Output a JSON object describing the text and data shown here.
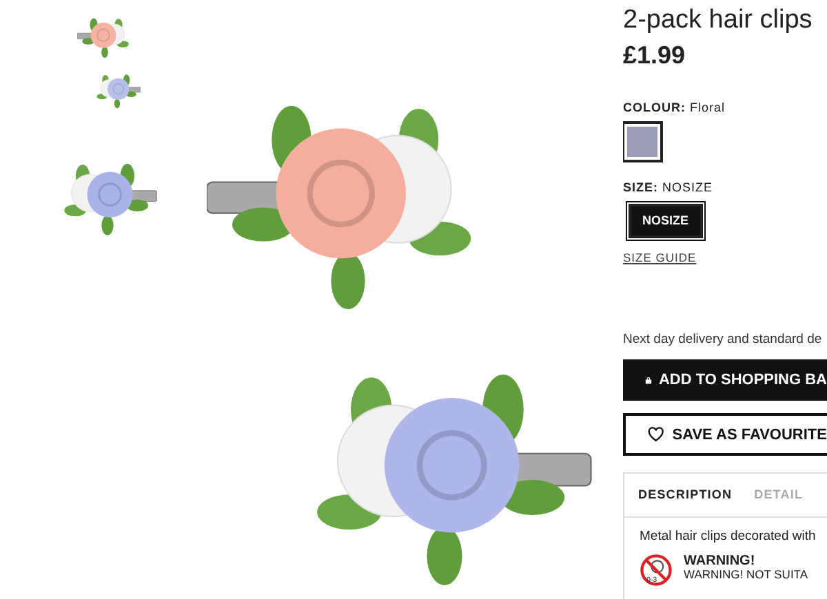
{
  "product": {
    "title": "2-pack hair clips",
    "price": "£1.99"
  },
  "colour": {
    "label": "COLOUR:",
    "value": "Floral",
    "swatches": [
      {
        "color": "#9a9cb8",
        "selected": true
      }
    ]
  },
  "size": {
    "label": "SIZE:",
    "value": "NOSIZE",
    "options": [
      {
        "label": "NOSIZE",
        "selected": true
      }
    ],
    "guide": "SIZE GUIDE"
  },
  "delivery": "Next day delivery and standard de",
  "buttons": {
    "add": "ADD TO SHOPPING BA",
    "save": "SAVE AS FAVOURITE"
  },
  "tabs": [
    {
      "label": "DESCRIPTION",
      "selected": true
    },
    {
      "label": "DETAIL",
      "selected": false
    }
  ],
  "description": "Metal hair clips decorated with",
  "warning": {
    "title": "WARNING!",
    "text": "WARNING! NOT SUITA",
    "badge": "0-3"
  }
}
